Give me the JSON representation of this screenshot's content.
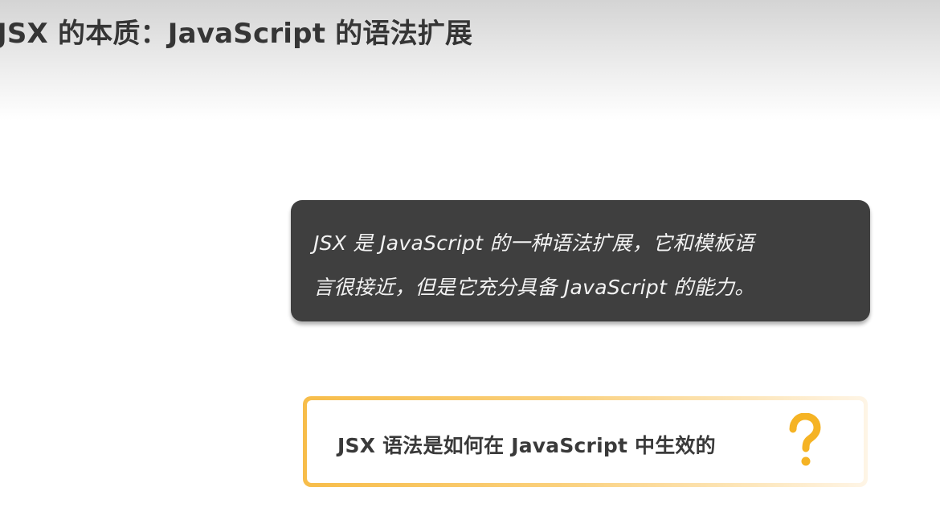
{
  "slide": {
    "title": "JSX 的本质：JavaScript 的语法扩展",
    "definition": {
      "line1": "JSX 是 JavaScript 的一种语法扩展，它和模板语",
      "line2": "言很接近，但是它充分具备 JavaScript 的能力。"
    },
    "question": {
      "text": "JSX 语法是如何在 JavaScript 中生效的",
      "icon": "question-mark-icon"
    }
  },
  "colors": {
    "title_text": "#353535",
    "definition_bg": "#3f3f3f",
    "definition_text": "#f2f2f2",
    "question_border": "#f7bd4a",
    "question_mark": "#f5b324"
  }
}
